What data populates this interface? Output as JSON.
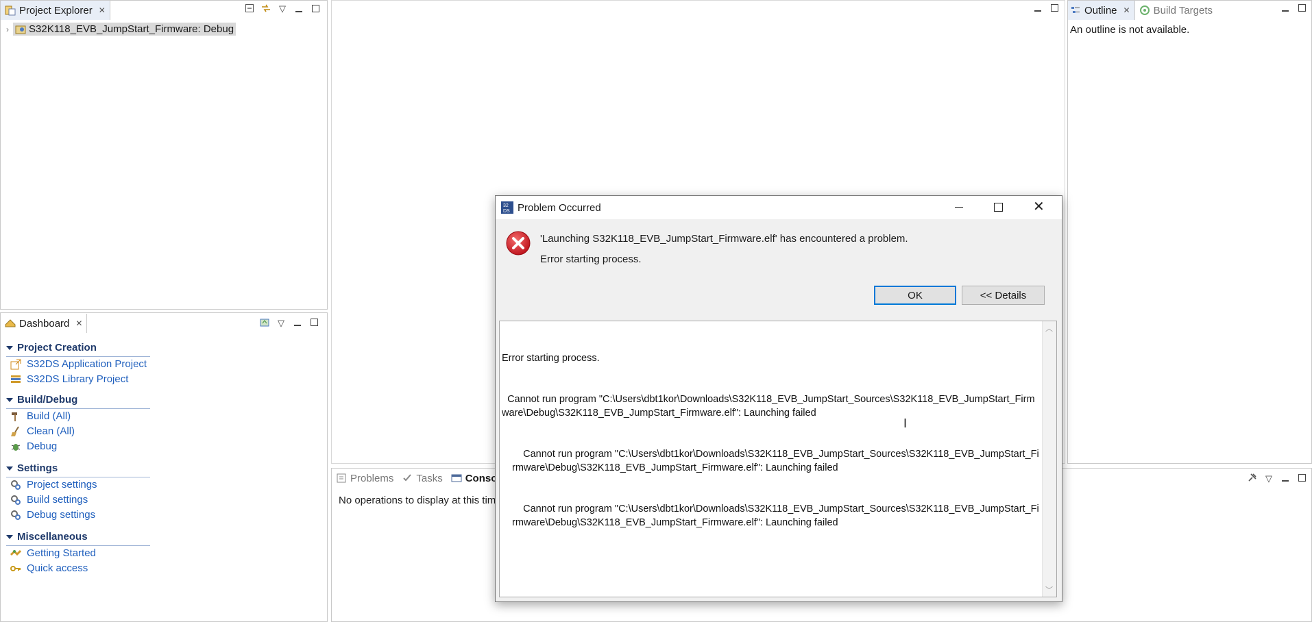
{
  "project_explorer": {
    "tab_label": "Project Explorer",
    "tree_item": "S32K118_EVB_JumpStart_Firmware: Debug"
  },
  "outline": {
    "tab_label": "Outline",
    "tab2_label": "Build Targets",
    "message": "An outline is not available."
  },
  "dashboard": {
    "tab_label": "Dashboard",
    "sections": [
      {
        "title": "Project Creation",
        "items": [
          "S32DS Application Project",
          "S32DS Library Project"
        ]
      },
      {
        "title": "Build/Debug",
        "items": [
          "Build  (All)",
          "Clean  (All)",
          "Debug"
        ]
      },
      {
        "title": "Settings",
        "items": [
          "Project settings",
          "Build settings",
          "Debug settings"
        ]
      },
      {
        "title": "Miscellaneous",
        "items": [
          "Getting Started",
          "Quick access"
        ]
      }
    ]
  },
  "bottom_panel": {
    "tabs": [
      "Problems",
      "Tasks",
      "Console"
    ],
    "message": "No operations to display at this tim"
  },
  "dialog": {
    "title": "Problem Occurred",
    "message": "'Launching S32K118_EVB_JumpStart_Firmware.elf' has encountered a problem.",
    "sub_message": "Error starting process.",
    "ok_label": "OK",
    "details_label": "<< Details",
    "details_lines": [
      "Error starting process.",
      "  Cannot run program \"C:\\Users\\dbt1kor\\Downloads\\S32K118_EVB_JumpStart_Sources\\S32K118_EVB_JumpStart_Firmware\\Debug\\S32K118_EVB_JumpStart_Firmware.elf\": Launching failed",
      "    Cannot run program \"C:\\Users\\dbt1kor\\Downloads\\S32K118_EVB_JumpStart_Sources\\S32K118_EVB_JumpStart_Firmware\\Debug\\S32K118_EVB_JumpStart_Firmware.elf\": Launching failed",
      "    Cannot run program \"C:\\Users\\dbt1kor\\Downloads\\S32K118_EVB_JumpStart_Sources\\S32K118_EVB_JumpStart_Firmware\\Debug\\S32K118_EVB_JumpStart_Firmware.elf\": Launching failed"
    ]
  },
  "colors": {
    "link": "#1f5fbd",
    "section_heading": "#1f3a6b",
    "error_red": "#d9232d",
    "default_button_border": "#0078d7"
  }
}
